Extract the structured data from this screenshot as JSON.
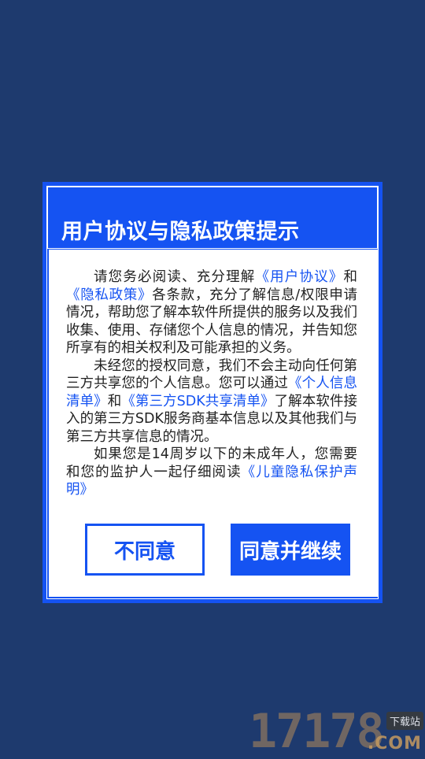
{
  "dialog": {
    "title": "用户协议与隐私政策提示",
    "paragraphs": [
      [
        {
          "text": "请您务必阅读、充分理解",
          "link": false
        },
        {
          "text": "《用户协议》",
          "link": true
        },
        {
          "text": "和",
          "link": false
        },
        {
          "text": "《隐私政策》",
          "link": true
        },
        {
          "text": "各条款，充分了解信息/权限申请情况，帮助您了解本软件所提供的服务以及我们收集、使用、存储您个人信息的情况，并告知您所享有的相关权利及可能承担的义务。",
          "link": false
        }
      ],
      [
        {
          "text": "未经您的授权同意，我们不会主动向任何第三方共享您的个人信息。您可以通过",
          "link": false
        },
        {
          "text": "《个人信息清单》",
          "link": true
        },
        {
          "text": "和",
          "link": false
        },
        {
          "text": "《第三方SDK共享清单》",
          "link": true
        },
        {
          "text": "了解本软件接入的第三方SDK服务商基本信息以及其他我们与第三方共享信息的情况。",
          "link": false
        }
      ],
      [
        {
          "text": "如果您是14周岁以下的未成年人，您需要和您的监护人一起仔细阅读",
          "link": false
        },
        {
          "text": "《儿童隐私保护声明》",
          "link": true
        }
      ]
    ],
    "buttons": {
      "disagree": "不同意",
      "agree": "同意并继续"
    }
  },
  "watermark": {
    "number": "17178",
    "badge": "下载站",
    "domain": ".COM"
  },
  "colors": {
    "background": "#1e3a6e",
    "accent": "#1553f2",
    "panel": "#ffffff",
    "text": "#222222"
  }
}
